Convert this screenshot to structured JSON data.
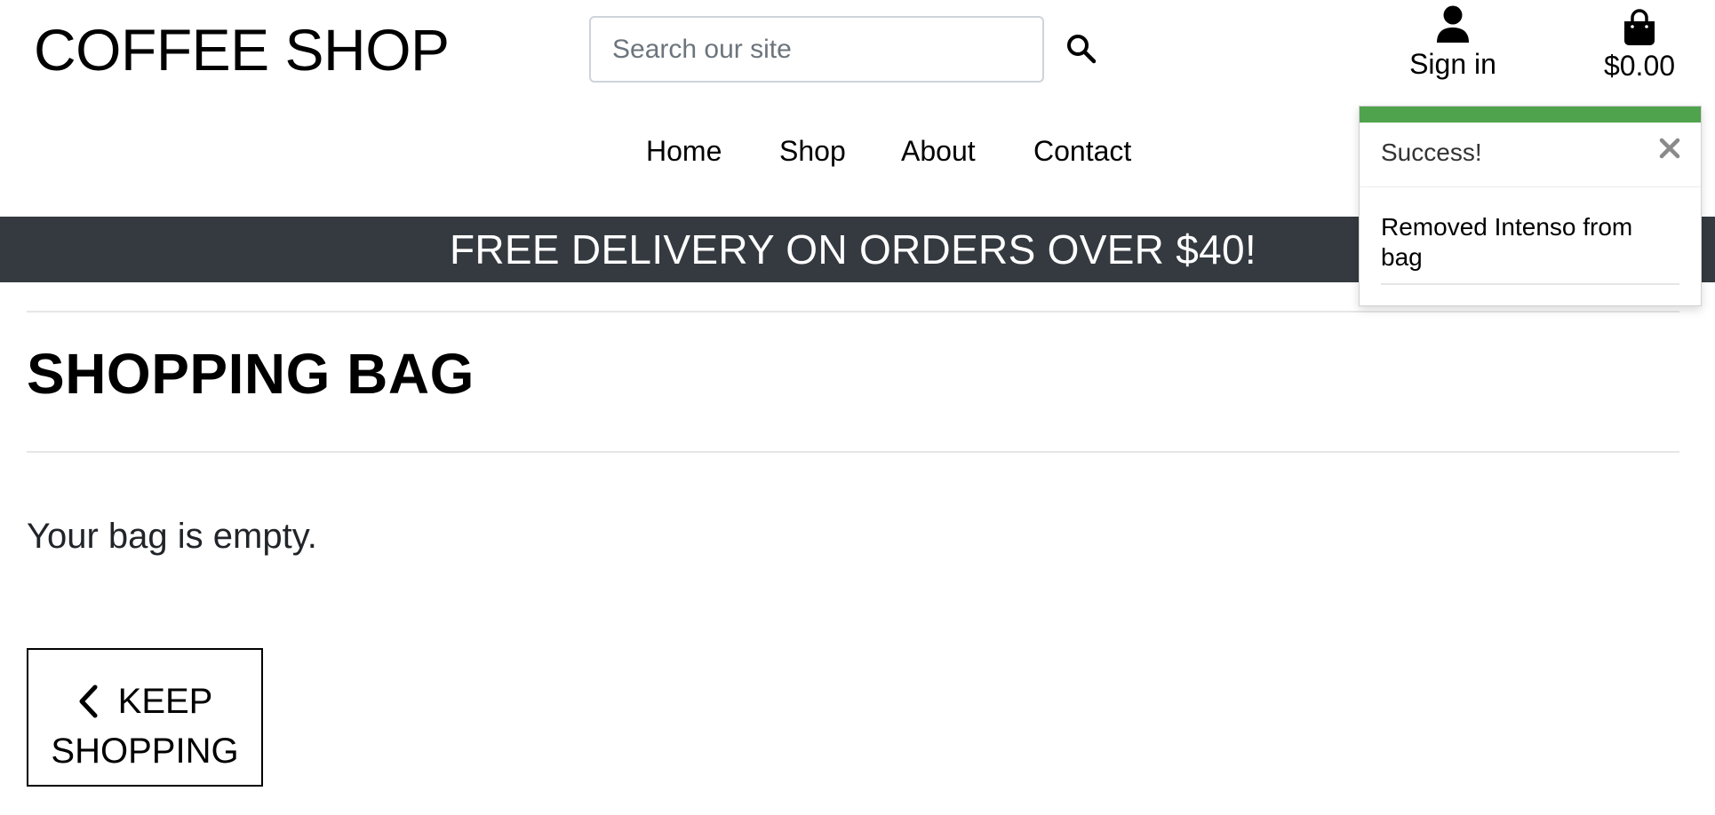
{
  "header": {
    "brand": "COFFEE SHOP",
    "search_placeholder": "Search our site",
    "account_label": "Sign in",
    "bag_total": "$0.00"
  },
  "nav": {
    "items": [
      "Home",
      "Shop",
      "About",
      "Contact"
    ]
  },
  "banner": {
    "text": "FREE DELIVERY ON ORDERS OVER $40!"
  },
  "main": {
    "title": "SHOPPING BAG",
    "empty_message": "Your bag is empty.",
    "keep_shopping_line1": "KEEP",
    "keep_shopping_line2": "SHOPPING"
  },
  "toast": {
    "title": "Success!",
    "message": "Removed Intenso from bag"
  },
  "icons": {
    "search": "search-icon",
    "account": "user-icon",
    "bag": "shopping-bag-icon",
    "close": "close-icon",
    "back": "chevron-left-icon"
  },
  "colors": {
    "banner_bg": "#343a40",
    "toast_accent": "#4fa34c",
    "input_border": "#ced4da"
  }
}
